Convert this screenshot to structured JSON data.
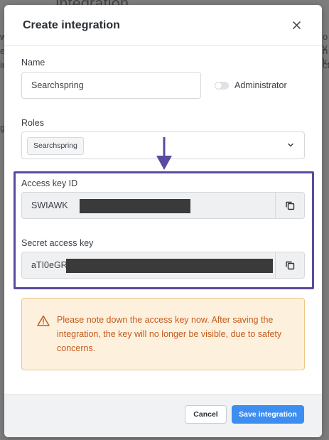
{
  "background": {
    "heading": "...integration",
    "fragments": [
      "wa",
      "er",
      "in",
      "g",
      "o v",
      "n k",
      "ct"
    ]
  },
  "modal": {
    "title": "Create integration",
    "close_label": "×",
    "name_label": "Name",
    "name_value": "Searchspring",
    "administrator_label": "Administrator",
    "administrator_on": false,
    "roles_label": "Roles",
    "roles_selected": [
      "Searchspring"
    ],
    "access_key_label": "Access key ID",
    "access_key_value": "SWIAWK",
    "secret_key_label": "Secret access key",
    "secret_key_value": "aTI0eGR",
    "warning_text": "Please note down the access key now. After saving the integration, the key will no longer be visible, due to safety concerns.",
    "cancel_label": "Cancel",
    "save_label": "Save integration"
  },
  "colors": {
    "highlight": "#5a4aa0",
    "warning_bg": "#fdf1de",
    "warning_text": "#c45a1b",
    "primary": "#3d8ef0"
  },
  "icons": [
    "close-icon",
    "chevron-down-icon",
    "copy-icon",
    "warning-triangle-icon",
    "arrow-down-icon"
  ]
}
